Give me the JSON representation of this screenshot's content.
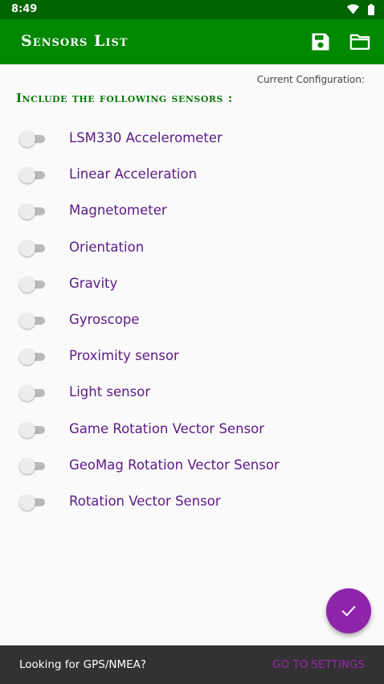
{
  "status_bar": {
    "time": "8:49",
    "icons": [
      "wifi-icon",
      "battery-icon"
    ]
  },
  "app_bar": {
    "title": "Sensors List",
    "actions": [
      "save-icon",
      "folder-icon"
    ],
    "color": "#008800"
  },
  "config": {
    "label": "Current Configuration:"
  },
  "heading": "Include the following sensors :",
  "sensors": [
    {
      "label": "LSM330 Accelerometer",
      "enabled": false
    },
    {
      "label": "Linear Acceleration",
      "enabled": false
    },
    {
      "label": "Magnetometer",
      "enabled": false
    },
    {
      "label": "Orientation",
      "enabled": false
    },
    {
      "label": "Gravity",
      "enabled": false
    },
    {
      "label": "Gyroscope",
      "enabled": false
    },
    {
      "label": "Proximity sensor",
      "enabled": false
    },
    {
      "label": "Light sensor",
      "enabled": false
    },
    {
      "label": "Game Rotation Vector Sensor",
      "enabled": false
    },
    {
      "label": "GeoMag Rotation Vector Sensor",
      "enabled": false
    },
    {
      "label": "Rotation Vector Sensor",
      "enabled": false
    }
  ],
  "fab": {
    "icon": "check-icon",
    "color": "#8e24aa"
  },
  "snackbar": {
    "text": "Looking for GPS/NMEA?",
    "action": "GO TO SETTINGS",
    "action_color": "#9c27b0"
  }
}
